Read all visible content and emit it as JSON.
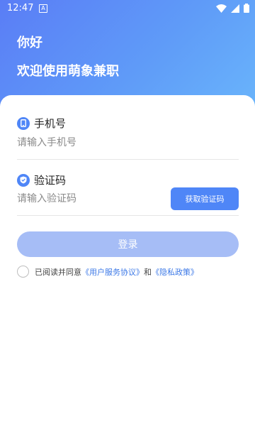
{
  "status_bar": {
    "time": "12:47",
    "notification_icon": "A",
    "icons": [
      "wifi-icon",
      "signal-icon",
      "battery-icon"
    ]
  },
  "header": {
    "greeting": "你好",
    "welcome": "欢迎使用萌象兼职"
  },
  "phone_field": {
    "label": "手机号",
    "placeholder": "请输入手机号",
    "icon": "phone-icon"
  },
  "code_field": {
    "label": "验证码",
    "placeholder": "请输入验证码",
    "icon": "shield-check-icon",
    "get_code_button": "获取验证码"
  },
  "login_button": "登录",
  "agreement": {
    "prefix": "已阅读并同意",
    "user_agreement": "《用户服务协议》",
    "conjunction": "和",
    "privacy_policy": "《隐私政策》"
  },
  "colors": {
    "header_gradient": [
      "#5a7df6",
      "#6ab6fb"
    ],
    "accent": "#4f86f7",
    "login_disabled": "#a6bdf6",
    "link": "#3b78e7"
  }
}
